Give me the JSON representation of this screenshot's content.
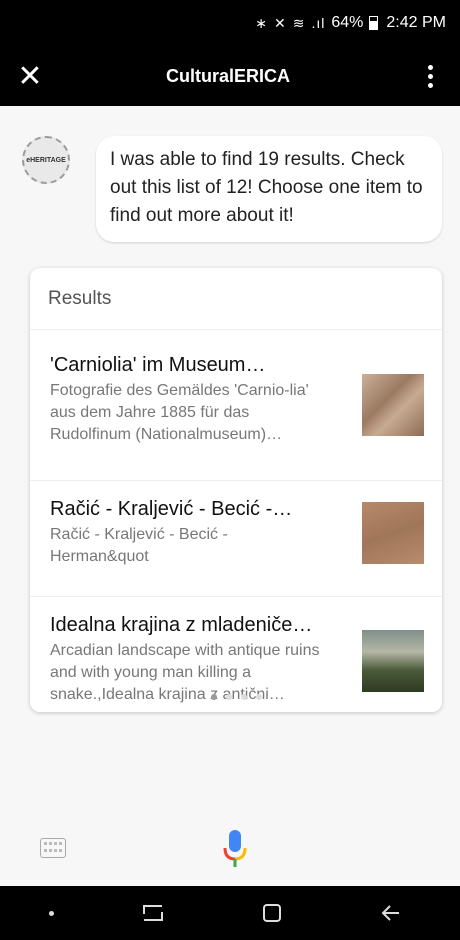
{
  "status_bar": {
    "icons": [
      "bluetooth-icon",
      "mute-icon",
      "wifi-icon",
      "lte-icon",
      "signal-icon"
    ],
    "battery": "64%",
    "time": "2:42 PM"
  },
  "app_bar": {
    "title": "CulturalERICA"
  },
  "chat": {
    "avatar_text": "eHERITAGE",
    "message": "I was able to find 19 results. Check out this list of 12! Choose one item to find out more about it!"
  },
  "results": {
    "header": "Results",
    "items": [
      {
        "title": "'Carniolia' im Museum…",
        "desc": "Fotografie des Gemäldes 'Carnio-lia' aus dem Jahre 1885 für das Rudolfinum (Nationalmuseum)…"
      },
      {
        "title": "Račić - Kraljević - Becić -…",
        "desc": "Račić - Kraljević - Becić - Herman&quot"
      },
      {
        "title": "Idealna krajina z mladeniče…",
        "desc": "Arcadian landscape with antique ruins and with young man killing a snake.,Idealna krajina z antični…"
      }
    ],
    "page_count": 4,
    "active_page": 1
  },
  "colors": {
    "mic_blue": "#4285F4",
    "mic_red": "#EA4335",
    "mic_yellow": "#FBBC05",
    "mic_green": "#34A853"
  }
}
